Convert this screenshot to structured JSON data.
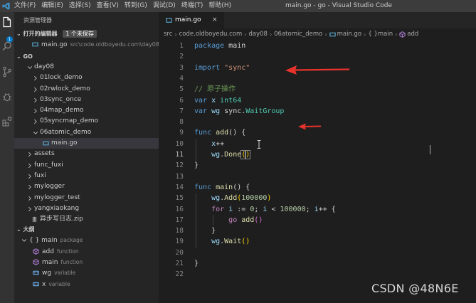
{
  "titlebar": {
    "menu": [
      "文件(F)",
      "编辑(E)",
      "选择(S)",
      "查看(V)",
      "转到(G)",
      "调试(D)",
      "终端(T)",
      "帮助(H)"
    ],
    "window_title": "main.go - go - Visual Studio Code"
  },
  "activitybar": {
    "items": [
      "explorer-icon",
      "search-icon",
      "source-control-icon",
      "debug-icon",
      "extensions-icon"
    ],
    "badge": "1"
  },
  "sidebar": {
    "title": "资源管理器",
    "open_editors": {
      "header": "打开的编辑器",
      "badge": "1 个未保存",
      "items": [
        {
          "name": "main.go",
          "path": "src\\code.oldboyedu.com\\day08\\..."
        }
      ]
    },
    "folder": {
      "header": "GO",
      "tree": [
        {
          "label": "day08",
          "kind": "folder-open",
          "depth": 1
        },
        {
          "label": "01lock_demo",
          "kind": "folder",
          "depth": 2
        },
        {
          "label": "02rwlock_demo",
          "kind": "folder",
          "depth": 2
        },
        {
          "label": "03sync_once",
          "kind": "folder",
          "depth": 2
        },
        {
          "label": "04map_demo",
          "kind": "folder",
          "depth": 2
        },
        {
          "label": "05syncmap_demo",
          "kind": "folder",
          "depth": 2
        },
        {
          "label": "06atomic_demo",
          "kind": "folder-open",
          "depth": 2
        },
        {
          "label": "main.go",
          "kind": "go-file",
          "depth": 3,
          "selected": true
        },
        {
          "label": "assets",
          "kind": "folder",
          "depth": 1
        },
        {
          "label": "func_fuxi",
          "kind": "folder",
          "depth": 1
        },
        {
          "label": "fuxi",
          "kind": "folder",
          "depth": 1
        },
        {
          "label": "mylogger",
          "kind": "folder",
          "depth": 1
        },
        {
          "label": "mylogger_test",
          "kind": "folder",
          "depth": 1
        },
        {
          "label": "yangxiaokang",
          "kind": "folder",
          "depth": 1
        },
        {
          "label": "异步写日志.zip",
          "kind": "zip-file",
          "depth": 1
        }
      ]
    },
    "outline": {
      "header": "大纲",
      "items": [
        {
          "name": "{ } main",
          "kind": "package",
          "icon": "package-icon",
          "depth": 0
        },
        {
          "name": "add",
          "kind": "function",
          "icon": "function-icon",
          "depth": 1
        },
        {
          "name": "main",
          "kind": "function",
          "icon": "function-icon",
          "depth": 1
        },
        {
          "name": "wg",
          "kind": "variable",
          "icon": "variable-icon",
          "depth": 1
        },
        {
          "name": "x",
          "kind": "variable",
          "icon": "variable-icon",
          "depth": 1
        }
      ]
    }
  },
  "editor": {
    "tab": {
      "label": "main.go",
      "close": "×"
    },
    "breadcrumb": [
      "src",
      "code.oldboyedu.com",
      "day08",
      "06atomic_demo",
      "main.go",
      "{ }main",
      "add"
    ],
    "active_line": 11,
    "lines": [
      [
        [
          "package ",
          "kw"
        ],
        [
          "main",
          "plain"
        ]
      ],
      [],
      [
        [
          "import ",
          "kw"
        ],
        [
          "\"sync\"",
          "str"
        ]
      ],
      [],
      [
        [
          "// 原子操作",
          "cm"
        ]
      ],
      [
        [
          "var ",
          "kw"
        ],
        [
          "x ",
          "var"
        ],
        [
          "int64",
          "ty"
        ]
      ],
      [
        [
          "var ",
          "kw"
        ],
        [
          "wg ",
          "var"
        ],
        [
          "sync.",
          "plain"
        ],
        [
          "WaitGroup",
          "ty"
        ]
      ],
      [],
      [
        [
          "func ",
          "kw"
        ],
        [
          "add",
          "fn"
        ],
        [
          "() ",
          "plain"
        ],
        [
          "{",
          "plain"
        ]
      ],
      [
        [
          "    x",
          "var"
        ],
        [
          "++",
          "plain"
        ]
      ],
      [
        [
          "    wg",
          "var"
        ],
        [
          ".",
          "plain"
        ],
        [
          "Done",
          "fn"
        ],
        [
          "(",
          "br-match"
        ],
        [
          ")",
          "br-match"
        ]
      ],
      [
        [
          "}",
          "plain"
        ]
      ],
      [],
      [
        [
          "func ",
          "kw"
        ],
        [
          "main",
          "fn"
        ],
        [
          "() ",
          "plain"
        ],
        [
          "{",
          "plain"
        ]
      ],
      [
        [
          "    wg",
          "var"
        ],
        [
          ".",
          "plain"
        ],
        [
          "Add",
          "fn"
        ],
        [
          "(",
          "br"
        ],
        [
          "100000",
          "num"
        ],
        [
          ")",
          "br"
        ]
      ],
      [
        [
          "    ",
          "plain"
        ],
        [
          "for ",
          "ctl"
        ],
        [
          "i",
          "var"
        ],
        [
          " := ",
          "plain"
        ],
        [
          "0",
          "num"
        ],
        [
          "; ",
          "plain"
        ],
        [
          "i",
          "var"
        ],
        [
          " < ",
          "plain"
        ],
        [
          "100000",
          "num"
        ],
        [
          "; ",
          "plain"
        ],
        [
          "i",
          "var"
        ],
        [
          "++ {",
          "plain"
        ]
      ],
      [
        [
          "        ",
          "plain"
        ],
        [
          "go ",
          "ctl"
        ],
        [
          "add",
          "fn"
        ],
        [
          "()",
          "br2"
        ]
      ],
      [
        [
          "    }",
          "plain"
        ]
      ],
      [
        [
          "    wg",
          "var"
        ],
        [
          ".",
          "plain"
        ],
        [
          "Wait",
          "fn"
        ],
        [
          "()",
          "br"
        ]
      ],
      [],
      [
        [
          "}",
          "plain"
        ]
      ],
      []
    ]
  },
  "watermark": "CSDN @48N6E",
  "colors": {
    "keyword": "#569cd6",
    "string": "#ce9178",
    "comment": "#6a9955",
    "function": "#dcdcaa",
    "type": "#4ec9b0",
    "variable": "#9cdcfe",
    "number": "#b5cea8",
    "control": "#c586c0",
    "annotation_arrow": "#e8332c",
    "accent": "#007acc"
  }
}
